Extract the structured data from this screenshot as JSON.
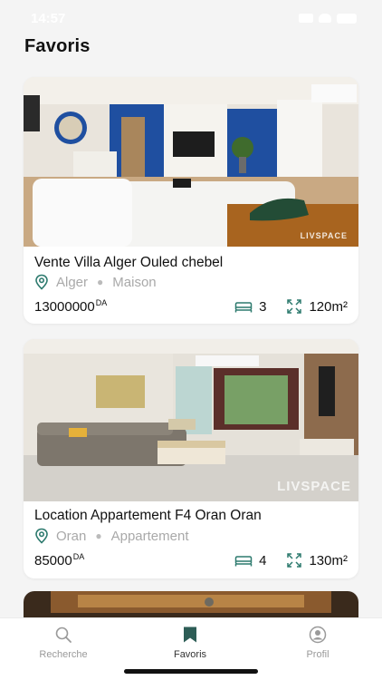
{
  "status_bar": {
    "time": "14:57"
  },
  "page": {
    "title": "Favoris"
  },
  "listings": [
    {
      "title": "Vente Villa Alger Ouled chebel",
      "city": "Alger",
      "type": "Maison",
      "price": "13000000",
      "currency": "DA",
      "rooms": "3",
      "area": "120m²",
      "watermark": "LIVSPACE"
    },
    {
      "title": "Location Appartement F4 Oran Oran",
      "city": "Oran",
      "type": "Appartement",
      "price": "85000",
      "currency": "DA",
      "rooms": "4",
      "area": "130m²",
      "watermark": "LIVSPACE"
    }
  ],
  "tabs": {
    "search": {
      "label": "Recherche",
      "icon": "search-icon"
    },
    "favorites": {
      "label": "Favoris",
      "icon": "bookmark-icon"
    },
    "profile": {
      "label": "Profil",
      "icon": "user-icon"
    }
  },
  "colors": {
    "accent": "#2d7a6e",
    "muted": "#a9a9a9",
    "active_tab": "#333333"
  }
}
